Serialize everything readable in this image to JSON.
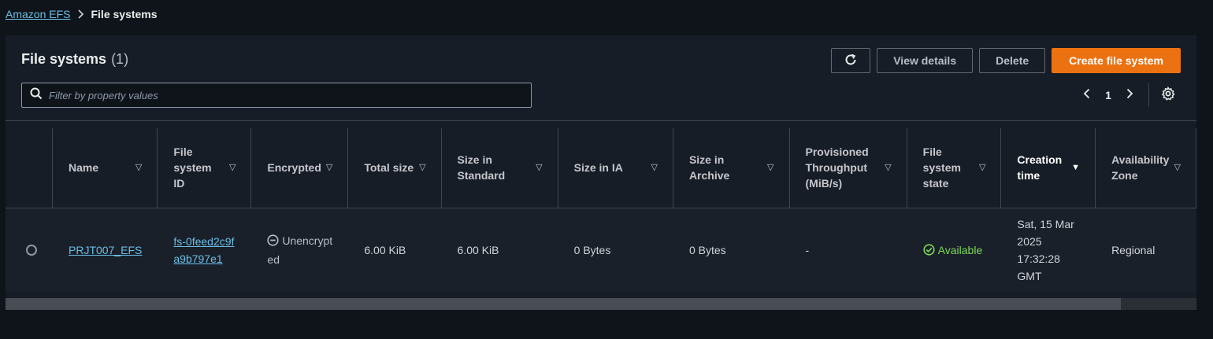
{
  "breadcrumb": {
    "parent": "Amazon EFS",
    "current": "File systems"
  },
  "panel": {
    "title": "File systems",
    "count": "(1)"
  },
  "actions": {
    "refresh_icon": "refresh-icon",
    "view_details": "View details",
    "delete": "Delete",
    "create": "Create file system"
  },
  "search": {
    "placeholder": "Filter by property values"
  },
  "pagination": {
    "page": "1"
  },
  "table": {
    "columns": [
      {
        "label": "Name",
        "sorted": false
      },
      {
        "label": "File system ID",
        "sorted": false
      },
      {
        "label": "Encrypted",
        "sorted": false
      },
      {
        "label": "Total size",
        "sorted": false
      },
      {
        "label": "Size in Standard",
        "sorted": false
      },
      {
        "label": "Size in IA",
        "sorted": false
      },
      {
        "label": "Size in Archive",
        "sorted": false
      },
      {
        "label": "Provisioned Throughput (MiB/s)",
        "sorted": false
      },
      {
        "label": "File system state",
        "sorted": false
      },
      {
        "label": "Creation time",
        "sorted": true
      },
      {
        "label": "Availability Zone",
        "sorted": false
      }
    ],
    "rows": [
      {
        "name": "PRJT007_EFS",
        "file_system_id": "fs-0feed2c9fa9b797e1",
        "encrypted": "Unencrypted",
        "total_size": "6.00 KiB",
        "size_standard": "6.00 KiB",
        "size_ia": "0 Bytes",
        "size_archive": "0 Bytes",
        "provisioned_throughput": "-",
        "state": "Available",
        "creation_time": "Sat, 15 Mar 2025 17:32:28 GMT",
        "availability_zone": "Regional"
      }
    ]
  },
  "colors": {
    "background": "#0f141a",
    "panel": "#161d26",
    "primary": "#ec7211",
    "link": "#6cbfe6",
    "success": "#7ed957"
  }
}
